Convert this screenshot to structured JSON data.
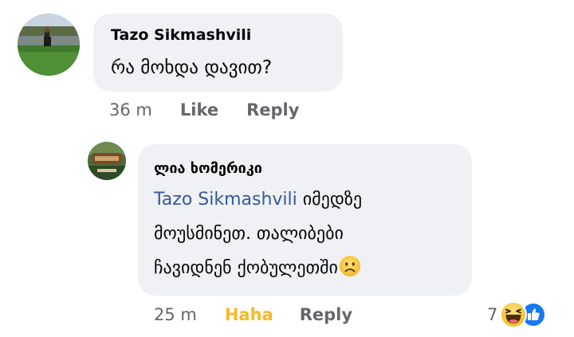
{
  "comment": {
    "author": "Tazo Sikmashvili",
    "text": "რა მოხდა დავით?",
    "time": "36 m",
    "like_label": "Like",
    "reply_label": "Reply"
  },
  "reply": {
    "author": "ლია ხომერიკი",
    "mention": "Tazo Sikmashvili",
    "line1_rest": " იმედზე",
    "line2": "მოუსმინეთ. თალიბები",
    "line3": "ჩავიდნენ ქობულეთში",
    "time": "25 m",
    "reaction_label": "Haha",
    "reply_label": "Reply",
    "reaction_count": "7"
  },
  "colors": {
    "bubble": "#eff1f4",
    "secondary_text": "#65676b",
    "mention": "#385898",
    "haha": "#f7b928",
    "like_blue": "#1877f2"
  },
  "icons": {
    "sad_emoji": "sad-face-icon",
    "haha_reaction": "haha-reaction-icon",
    "like_reaction": "like-reaction-icon"
  }
}
